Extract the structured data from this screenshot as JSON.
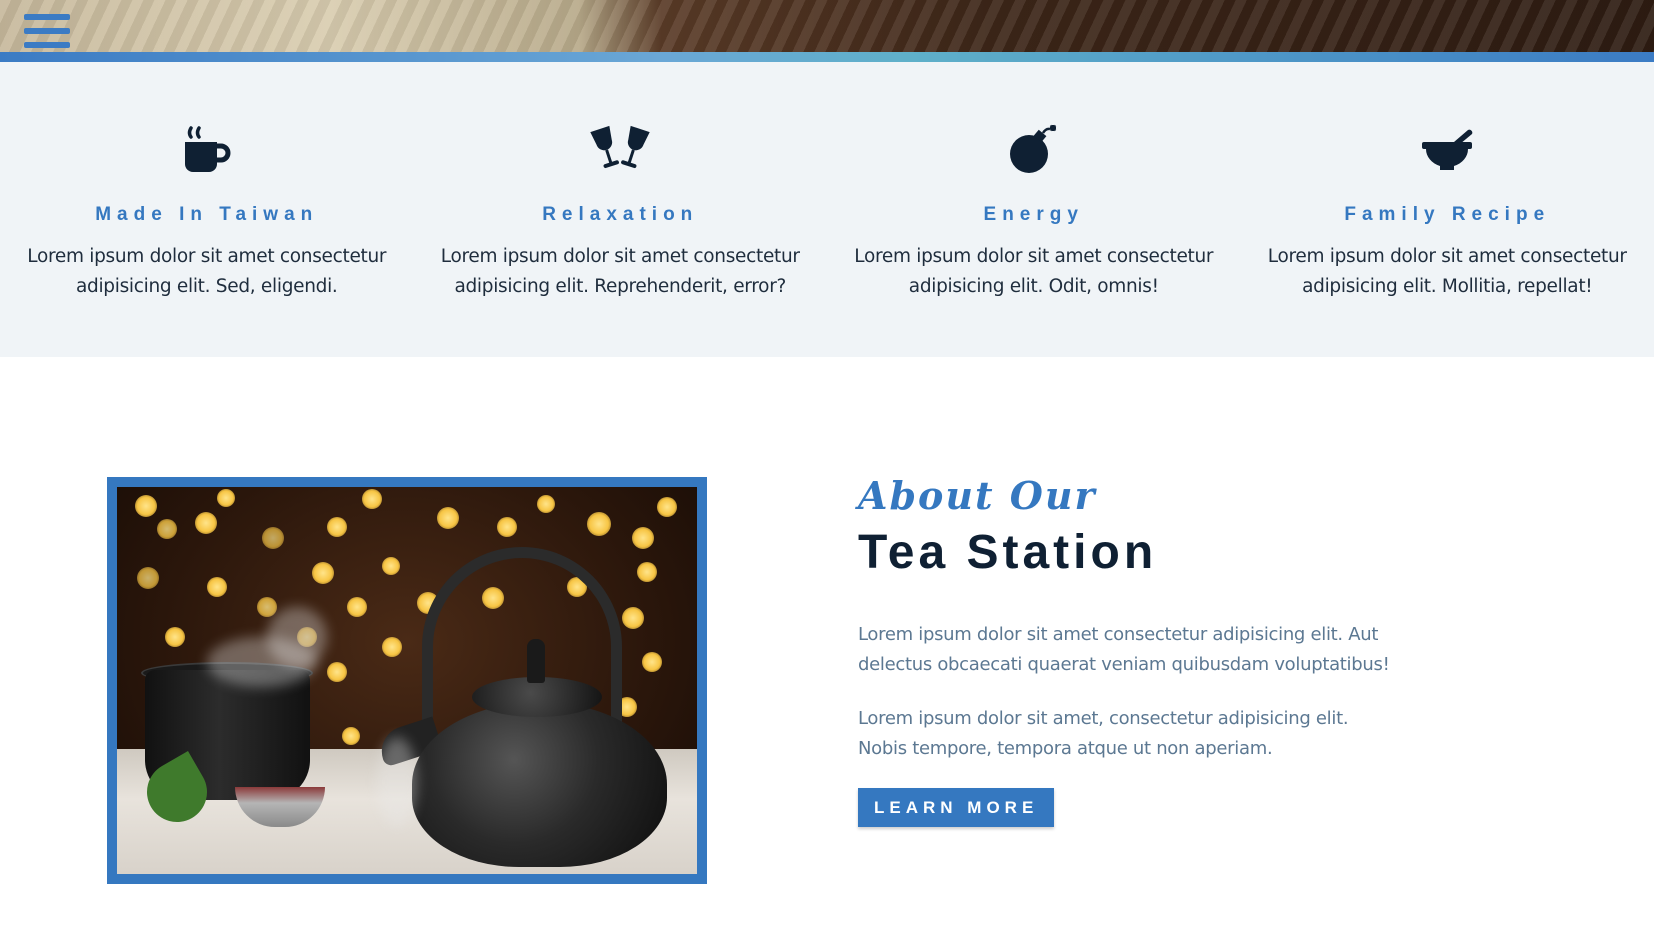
{
  "nav": {
    "menu_icon": "hamburger-menu-icon"
  },
  "features": [
    {
      "icon": "coffee-cup-icon",
      "title": "Made In Taiwan",
      "text": "Lorem ipsum dolor sit amet consectetur adipisicing elit. Sed, eligendi."
    },
    {
      "icon": "glass-cheers-icon",
      "title": "Relaxation",
      "text": "Lorem ipsum dolor sit amet consectetur adipisicing elit. Reprehenderit, error?"
    },
    {
      "icon": "bomb-icon",
      "title": "Energy",
      "text": "Lorem ipsum dolor sit amet consectetur adipisicing elit. Odit, omnis!"
    },
    {
      "icon": "mortar-pestle-icon",
      "title": "Family Recipe",
      "text": "Lorem ipsum dolor sit amet consectetur adipisicing elit. Mollitia, repellat!"
    }
  ],
  "about": {
    "script_heading": "About Our",
    "title": "Tea Station",
    "paragraph_1": "Lorem ipsum dolor sit amet consectetur adipisicing elit. Aut delectus obcaecati quaerat veniam quibusdam voluptatibus!",
    "paragraph_2": "Lorem ipsum dolor sit amet, consectetur adipisicing elit. Nobis tempore, tempora atque ut non aperiam.",
    "button_label": "LEARN MORE"
  },
  "colors": {
    "accent": "#3578c0",
    "dark": "#0f2033",
    "band_bg": "#f0f4f7",
    "muted_text": "#5c7892"
  }
}
